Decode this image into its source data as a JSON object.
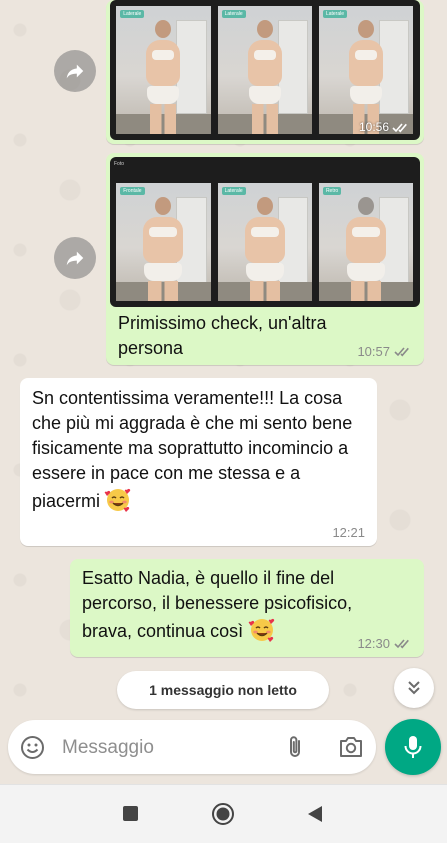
{
  "colors": {
    "outgoing_bubble": "#dcf8c6",
    "incoming_bubble": "#ffffff",
    "accent": "#00a884",
    "read_ticks": "#8a8a8a"
  },
  "messages": [
    {
      "direction": "outgoing",
      "type": "image",
      "forwarded": true,
      "photo_tags": [
        "Laterale",
        "Laterale",
        "Laterale"
      ],
      "time": "10:56",
      "status_icon": "double-check-icon"
    },
    {
      "direction": "outgoing",
      "type": "image-with-caption",
      "forwarded": true,
      "photo_header": "Foto",
      "photo_tags": [
        "Frontale",
        "Laterale",
        "Retro"
      ],
      "caption": "Primissimo check, un'altra persona",
      "time": "10:57",
      "status_icon": "double-check-icon"
    },
    {
      "direction": "incoming",
      "type": "text",
      "text": "Sn contentissima veramente!!! La cosa che più mi aggrada è che mi sento bene fisicamente ma soprattutto incomincio a essere in pace con me stessa e a piacermi",
      "emoji": "smiling-face-with-hearts-emoji",
      "time": "12:21"
    },
    {
      "direction": "outgoing",
      "type": "text",
      "text": "Esatto Nadia, è quello il fine del percorso, il benessere psicofisico, brava, continua così",
      "emoji": "smiling-face-with-hearts-emoji",
      "time": "12:30",
      "status_icon": "double-check-icon"
    }
  ],
  "unread_banner": "1 messaggio non letto",
  "composer": {
    "placeholder": "Messaggio",
    "value": ""
  },
  "icons": {
    "forward": "forward-icon",
    "scroll_down": "double-chevron-down-icon",
    "emoji": "emoji-icon",
    "attach": "paperclip-icon",
    "camera": "camera-icon",
    "mic": "microphone-icon",
    "nav_recents": "square-icon",
    "nav_home": "circle-icon",
    "nav_back": "triangle-back-icon"
  }
}
